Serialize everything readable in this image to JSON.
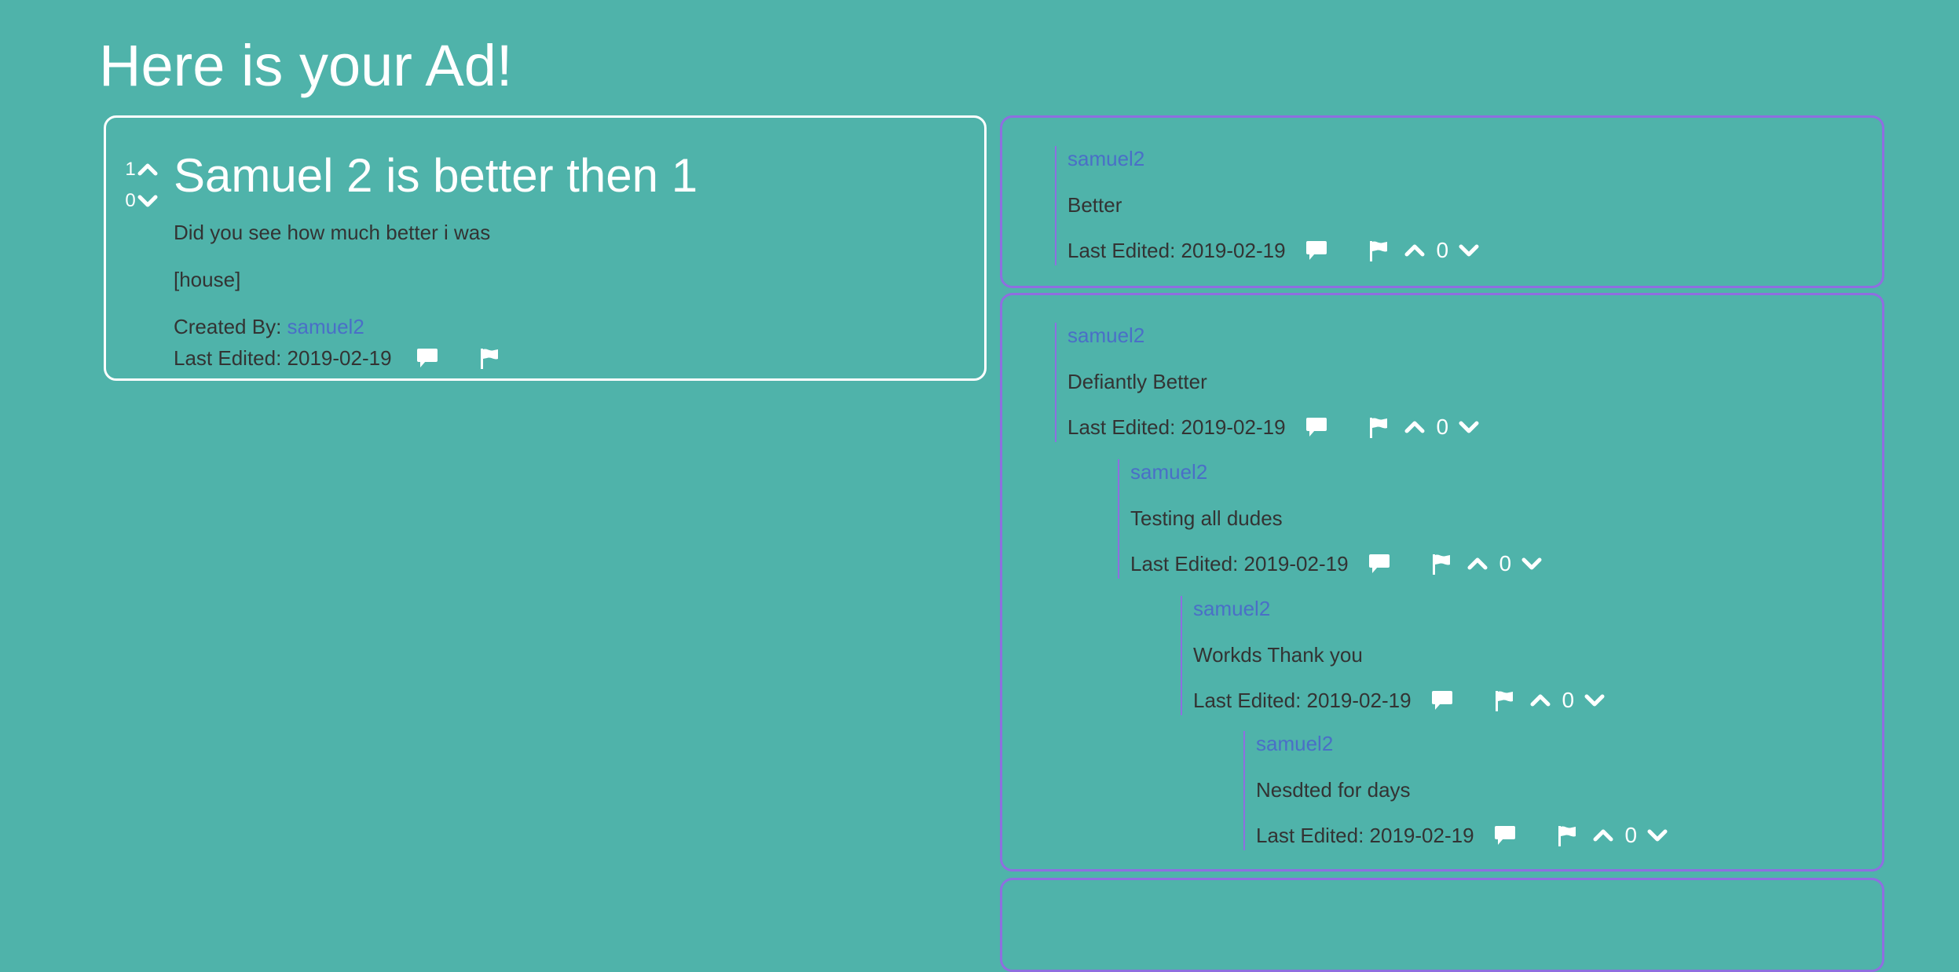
{
  "page": {
    "title": "Here is your Ad!"
  },
  "ad": {
    "upvotes": "1",
    "downvotes": "0",
    "title": "Samuel 2 is better then 1",
    "description": "Did you see how much better i was",
    "tag": "[house]",
    "created_by_label": "Created By: ",
    "author": "samuel2",
    "last_edited": "Last Edited: 2019-02-19"
  },
  "threads": [
    {
      "comments": [
        {
          "user": "samuel2",
          "text": "Better",
          "last_edited": "Last Edited: 2019-02-19",
          "score": "0"
        }
      ]
    },
    {
      "comments": [
        {
          "user": "samuel2",
          "text": "Defiantly Better",
          "last_edited": "Last Edited: 2019-02-19",
          "score": "0"
        },
        {
          "user": "samuel2",
          "text": "Testing all dudes",
          "last_edited": "Last Edited: 2019-02-19",
          "score": "0"
        },
        {
          "user": "samuel2",
          "text": "Workds Thank you",
          "last_edited": "Last Edited: 2019-02-19",
          "score": "0"
        },
        {
          "user": "samuel2",
          "text": "Nesdted for days",
          "last_edited": "Last Edited: 2019-02-19",
          "score": "0"
        }
      ]
    }
  ],
  "colors": {
    "background": "#4fb3aa",
    "ad_border": "#ffffff",
    "thread_border": "#8f6ee0",
    "link": "#4a6fc7"
  },
  "icons": {
    "upvote": "chevron-up-icon",
    "downvote": "chevron-down-icon",
    "reply": "comment-icon",
    "report": "flag-icon"
  }
}
